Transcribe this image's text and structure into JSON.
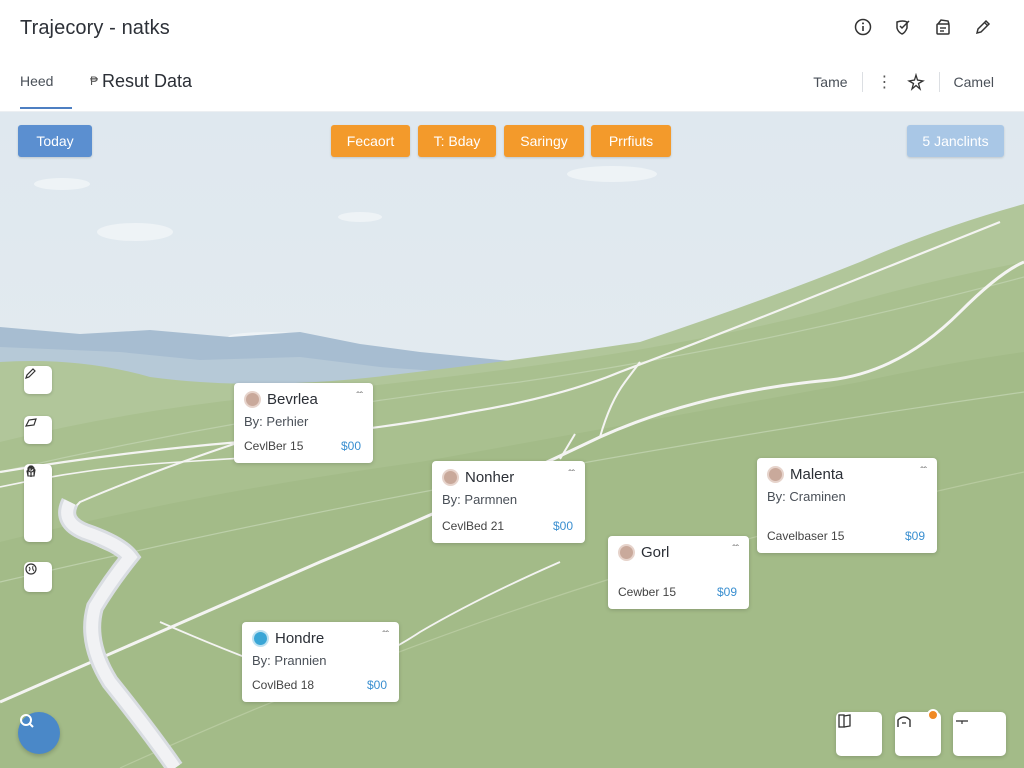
{
  "header": {
    "title": "Trajecory - natks",
    "icons": [
      "info-icon",
      "shield-check-icon",
      "archive-icon",
      "edit-icon"
    ]
  },
  "subheader": {
    "tab_label": "Heed",
    "separator": "₱",
    "result_title": "Resut Data",
    "time_label": "Tame",
    "cancel_label": "Camel"
  },
  "map": {
    "chips": {
      "today": "Today",
      "filters": [
        "Fecaort",
        "T: Bday",
        "Saringy",
        "Prrfiuts"
      ],
      "junctions": "5 Janclints"
    },
    "cards": [
      {
        "name": "Bevrlea",
        "by": "By: Perhier",
        "footer": "CevlBer 15",
        "price": "$00"
      },
      {
        "name": "Nonher",
        "by": "By: Parmnen",
        "footer": "CevlBed 21",
        "price": "$00"
      },
      {
        "name": "Malenta",
        "by": "By: Craminen",
        "footer": "Cavelbaser 15",
        "price": "$09"
      },
      {
        "name": "Gorl",
        "by": "",
        "footer": "Cewber 15",
        "price": "$09"
      },
      {
        "name": "Hondre",
        "by": "By: Prannien",
        "footer": "CovlBed 18",
        "price": "$00"
      }
    ],
    "colors": {
      "sky": "#dde7ee",
      "hill": "#a9c08f",
      "road": "#f4f4f2",
      "accent_orange": "#f39a2b",
      "accent_blue": "#5b8fd0"
    }
  }
}
